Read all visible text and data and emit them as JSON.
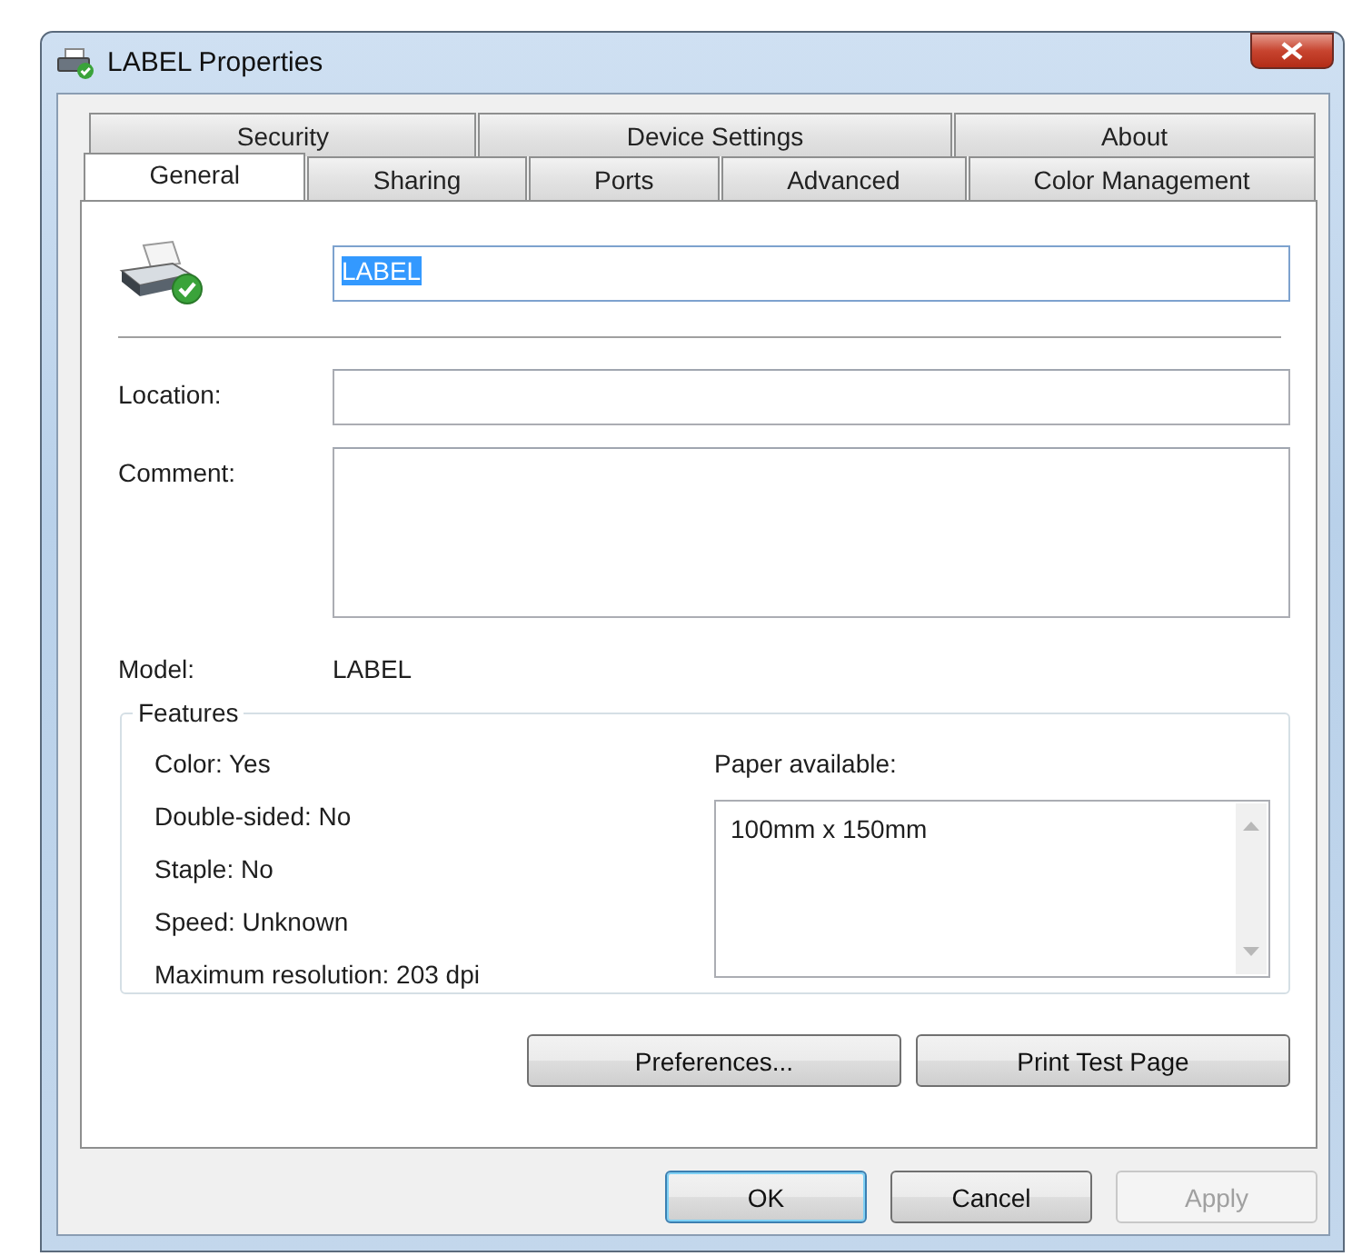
{
  "window": {
    "title": "LABEL Properties"
  },
  "tab_rows": [
    [
      {
        "label": "Security",
        "selected": false
      },
      {
        "label": "Device Settings",
        "selected": false
      },
      {
        "label": "About",
        "selected": false
      }
    ],
    [
      {
        "label": "General",
        "selected": true
      },
      {
        "label": "Sharing",
        "selected": false
      },
      {
        "label": "Ports",
        "selected": false
      },
      {
        "label": "Advanced",
        "selected": false
      },
      {
        "label": "Color Management",
        "selected": false
      }
    ]
  ],
  "general": {
    "printer_name": {
      "value": "LABEL",
      "text_selected": true
    },
    "location": {
      "label": "Location:"
    },
    "comment": {
      "label": "Comment:"
    },
    "model": {
      "label": "Model:",
      "value": "LABEL"
    },
    "features": {
      "title": "Features",
      "items": [
        "Color: Yes",
        "Double-sided: No",
        "Staple: No",
        "Speed: Unknown",
        "Maximum resolution: 203 dpi"
      ],
      "paper_label": "Paper available:",
      "paper_list": [
        "100mm x 150mm"
      ]
    },
    "panel_buttons": [
      {
        "label": "Preferences..."
      },
      {
        "label": "Print Test Page"
      }
    ]
  },
  "dialog_buttons": [
    {
      "label": "OK",
      "default": true,
      "disabled": false
    },
    {
      "label": "Cancel",
      "default": false,
      "disabled": false
    },
    {
      "label": "Apply",
      "default": false,
      "disabled": true
    }
  ]
}
